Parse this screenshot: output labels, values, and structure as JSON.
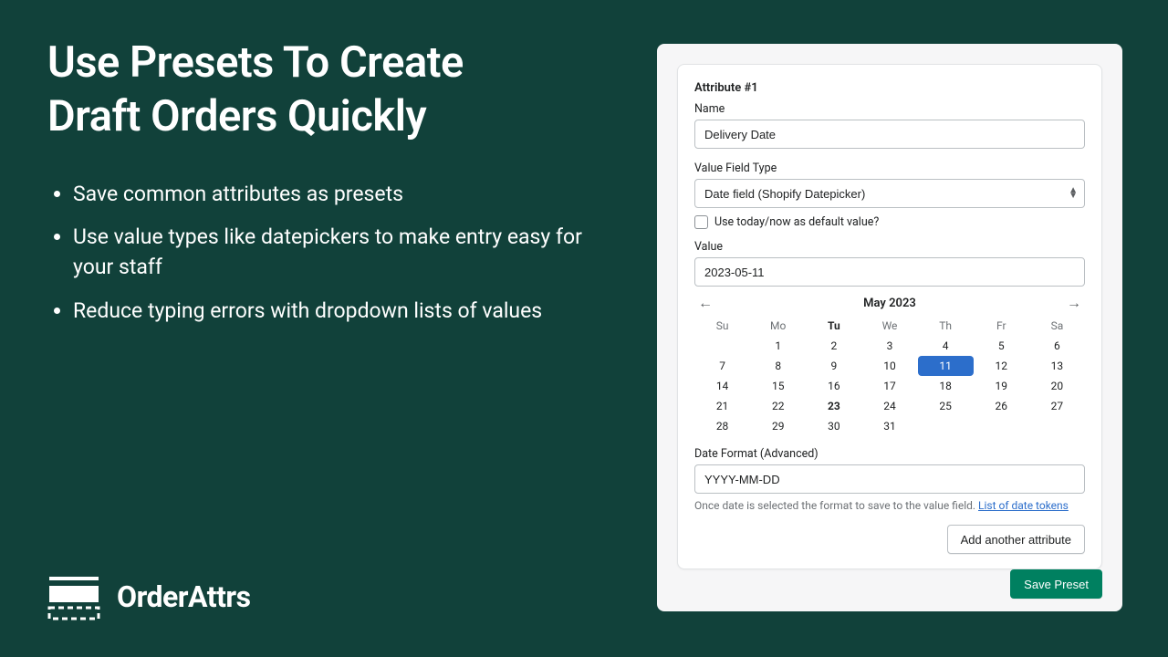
{
  "headline_line1": "Use Presets To Create",
  "headline_line2": "Draft Orders Quickly",
  "bullets": [
    "Save common attributes as presets",
    "Use value types like datepickers to make entry easy for your staff",
    "Reduce typing errors with dropdown lists of values"
  ],
  "brand": {
    "name": "OrderAttrs"
  },
  "form": {
    "card_title": "Attribute #1",
    "name_label": "Name",
    "name_value": "Delivery Date",
    "type_label": "Value Field Type",
    "type_value": "Date field (Shopify Datepicker)",
    "default_today_label": "Use today/now as default value?",
    "value_label": "Value",
    "value_value": "2023-05-11",
    "calendar": {
      "month_label": "May 2023",
      "dow": [
        "Su",
        "Mo",
        "Tu",
        "We",
        "Th",
        "Fr",
        "Sa"
      ],
      "weeks": [
        [
          "",
          "1",
          "2",
          "3",
          "4",
          "5",
          "6"
        ],
        [
          "7",
          "8",
          "9",
          "10",
          "11",
          "12",
          "13"
        ],
        [
          "14",
          "15",
          "16",
          "17",
          "18",
          "19",
          "20"
        ],
        [
          "21",
          "22",
          "23",
          "24",
          "25",
          "26",
          "27"
        ],
        [
          "28",
          "29",
          "30",
          "31",
          "",
          "",
          ""
        ]
      ],
      "selected": "11",
      "today": "23"
    },
    "format_label": "Date Format (Advanced)",
    "format_value": "YYYY-MM-DD",
    "format_help_pre": "Once date is selected the format to save to the value field. ",
    "format_help_link": "List of date tokens",
    "add_button": "Add another attribute",
    "save_button": "Save Preset"
  }
}
